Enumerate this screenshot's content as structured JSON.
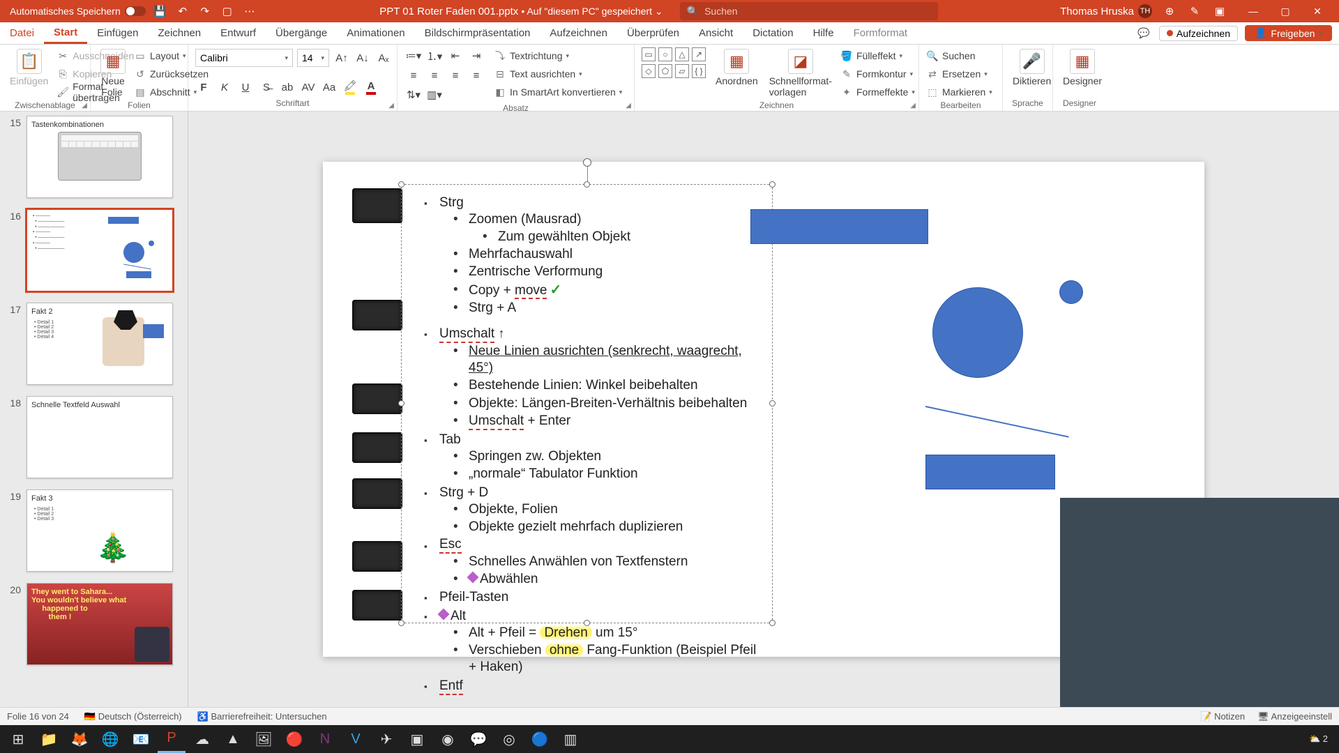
{
  "titlebar": {
    "autosave": "Automatisches Speichern",
    "filename": "PPT 01 Roter Faden 001.pptx",
    "saved_location": "• Auf \"diesem PC\" gespeichert ⌄",
    "search_placeholder": "Suchen",
    "user_name": "Thomas Hruska",
    "user_initials": "TH"
  },
  "menu": {
    "items": [
      "Datei",
      "Start",
      "Einfügen",
      "Zeichnen",
      "Entwurf",
      "Übergänge",
      "Animationen",
      "Bildschirmpräsentation",
      "Aufzeichnen",
      "Überprüfen",
      "Ansicht",
      "Dictation",
      "Hilfe",
      "Formformat"
    ],
    "record": "Aufzeichnen",
    "share": "Freigeben"
  },
  "ribbon": {
    "clipboard": {
      "label": "Zwischenablage",
      "paste": "Einfügen",
      "cut": "Ausschneiden",
      "copy": "Kopieren",
      "fmt": "Format übertragen"
    },
    "slides": {
      "label": "Folien",
      "new": "Neue\nFolie",
      "layout": "Layout",
      "reset": "Zurücksetzen",
      "section": "Abschnitt"
    },
    "font": {
      "label": "Schriftart",
      "name": "Calibri",
      "size": "14"
    },
    "paragraph": {
      "label": "Absatz",
      "textdir": "Textrichtung",
      "align": "Text ausrichten",
      "smartart": "In SmartArt konvertieren"
    },
    "drawing": {
      "label": "Zeichnen",
      "arrange": "Anordnen",
      "quick": "Schnellformat-\nvorlagen",
      "fill": "Fülleffekt",
      "outline": "Formkontur",
      "effects": "Formeffekte"
    },
    "editing": {
      "label": "Bearbeiten",
      "find": "Suchen",
      "replace": "Ersetzen",
      "select": "Markieren"
    },
    "voice": {
      "label": "Sprache",
      "dictate": "Diktieren"
    },
    "designer": {
      "label": "Designer",
      "btn": "Designer"
    }
  },
  "thumbs": [
    {
      "n": "15",
      "title": "Tastenkombinationen"
    },
    {
      "n": "16",
      "title": ""
    },
    {
      "n": "17",
      "title": "Fakt 2"
    },
    {
      "n": "18",
      "title": "Schnelle Textfeld Auswahl"
    },
    {
      "n": "19",
      "title": "Fakt 3"
    },
    {
      "n": "20",
      "title": ""
    }
  ],
  "slide": {
    "strg": {
      "h": "Strg",
      "i": [
        "Zoomen (Mausrad)",
        "Zum gewählten Objekt",
        "Mehrfachauswahl",
        "Zentrische Verformung",
        "Copy + ",
        "move",
        "Strg + A"
      ]
    },
    "umschalt": {
      "h": "Umschalt",
      "arrow": "↑",
      "i": [
        "Neue Linien ausrichten (senkrecht, waagrecht, 45°)",
        "Bestehende Linien: Winkel beibehalten",
        "Objekte: Längen-Breiten-Verhältnis beibehalten",
        "Umschalt",
        " + Enter"
      ]
    },
    "tab": {
      "h": "Tab",
      "i": [
        "Springen zw. Objekten",
        "„normale“ Tabulator Funktion"
      ]
    },
    "strgd": {
      "h": "Strg + D",
      "i": [
        "Objekte, Folien",
        "Objekte gezielt mehrfach duplizieren"
      ]
    },
    "esc": {
      "h": "Esc",
      "i": [
        "Schnelles Anwählen von Textfenstern",
        "Abwählen"
      ]
    },
    "pfeil": {
      "h": "Pfeil-Tasten"
    },
    "alt": {
      "h": "Alt",
      "i": [
        "Alt + Pfeil = ",
        "Drehen",
        " um 15°",
        "Verschieben ",
        "ohne",
        " Fang-Funktion (Beispiel Pfeil + Haken)"
      ]
    },
    "entf": {
      "h": "Entf"
    }
  },
  "status": {
    "slide": "Folie 16 von 24",
    "lang": "Deutsch (Österreich)",
    "access": "Barrierefreiheit: Untersuchen",
    "notes": "Notizen",
    "display": "Anzeigeeinstell"
  },
  "taskbar": {
    "temp": "2"
  }
}
